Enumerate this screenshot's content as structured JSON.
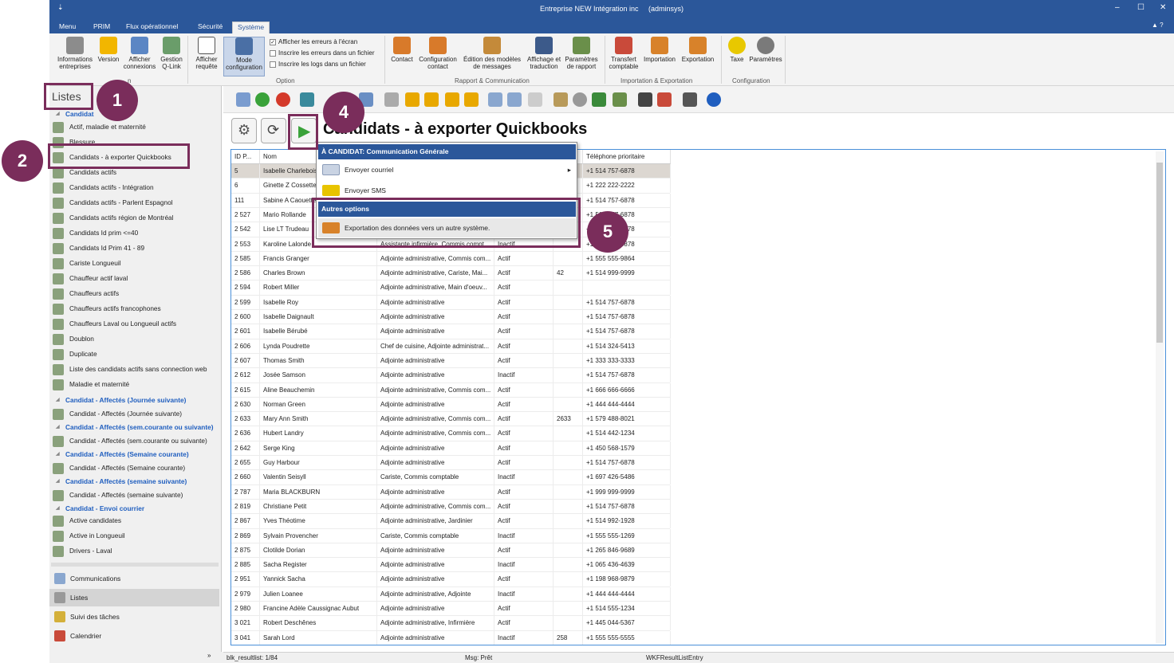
{
  "window": {
    "title": "Entreprise NEW Intégration inc",
    "user": "(adminsys)",
    "controls": [
      "–",
      "☐",
      "✕"
    ]
  },
  "menu_tabs": [
    "Menu",
    "PRIM",
    "Flux opérationnel",
    "Sécurité",
    "Système"
  ],
  "ribbon": {
    "buttons": [
      {
        "label": "Informations entreprises",
        "icon": "building-icon"
      },
      {
        "label": "Version",
        "icon": "warning-icon"
      },
      {
        "label": "Afficher connexions",
        "icon": "network-icon"
      },
      {
        "label": "Gestion Q-Link",
        "icon": "link-icon"
      },
      {
        "label": "Afficher requête",
        "icon": "log-icon"
      },
      {
        "label": "Mode configuration",
        "icon": "globe-icon"
      },
      {
        "label": "Contact",
        "icon": "contact-icon"
      },
      {
        "label": "Configuration contact",
        "icon": "contact-config-icon"
      },
      {
        "label": "Édition des modèles de messages",
        "icon": "edit-icon"
      },
      {
        "label": "Affichage et traduction",
        "icon": "translate-icon"
      },
      {
        "label": "Paramètres de rapport",
        "icon": "report-icon"
      },
      {
        "label": "Transfert comptable",
        "icon": "transfer-icon"
      },
      {
        "label": "Importation",
        "icon": "import-icon"
      },
      {
        "label": "Exportation",
        "icon": "export-icon"
      },
      {
        "label": "Taxe",
        "icon": "tax-icon"
      },
      {
        "label": "Paramètres",
        "icon": "gear-icon"
      }
    ],
    "checkboxes": [
      {
        "label": "Afficher les erreurs à l'écran",
        "checked": true
      },
      {
        "label": "Inscrire les erreurs dans un fichier",
        "checked": false
      },
      {
        "label": "Inscrire les logs dans un fichier",
        "checked": false
      }
    ],
    "groups": [
      "n",
      "Option",
      "Rapport & Communication",
      "Importation & Exportation",
      "Configuration"
    ]
  },
  "sidebar": {
    "title": "Listes",
    "items": [
      {
        "type": "head",
        "label": "Candidat"
      },
      {
        "type": "item",
        "label": "Actif, maladie et maternité"
      },
      {
        "type": "item",
        "label": "Blessure"
      },
      {
        "type": "item",
        "label": "Candidats - à exporter Quickbooks"
      },
      {
        "type": "item",
        "label": "Candidats actifs"
      },
      {
        "type": "item",
        "label": "Candidats actifs - Intégration"
      },
      {
        "type": "item",
        "label": "Candidats actifs - Parlent Espagnol"
      },
      {
        "type": "item",
        "label": "Candidats actifs région de Montréal"
      },
      {
        "type": "item",
        "label": "Candidats Id prim <=40"
      },
      {
        "type": "item",
        "label": "Candidats Id Prim 41 - 89"
      },
      {
        "type": "item",
        "label": "Cariste Longueuil"
      },
      {
        "type": "item",
        "label": "Chauffeur actif laval"
      },
      {
        "type": "item",
        "label": "Chauffeurs actifs"
      },
      {
        "type": "item",
        "label": "Chauffeurs actifs francophones"
      },
      {
        "type": "item",
        "label": "Chauffeurs Laval ou Longueuil actifs"
      },
      {
        "type": "item",
        "label": "Doublon"
      },
      {
        "type": "item",
        "label": "Duplicate"
      },
      {
        "type": "item",
        "label": "Liste des candidats actifs sans connection web"
      },
      {
        "type": "item",
        "label": "Maladie et maternité"
      },
      {
        "type": "head",
        "label": "Candidat - Affectés (Journée suivante)"
      },
      {
        "type": "item",
        "label": "Candidat - Affectés (Journée suivante)"
      },
      {
        "type": "head",
        "label": "Candidat - Affectés (sem.courante ou suivante)"
      },
      {
        "type": "item",
        "label": "Candidat - Affectés (sem.courante ou suivante)"
      },
      {
        "type": "head",
        "label": "Candidat - Affectés (Semaine courante)"
      },
      {
        "type": "item",
        "label": "Candidat - Affectés (Semaine courante)"
      },
      {
        "type": "head",
        "label": "Candidat - Affectés (semaine suivante)"
      },
      {
        "type": "item",
        "label": "Candidat - Affectés (semaine suivante)"
      },
      {
        "type": "head",
        "label": "Candidat - Envoi courrier"
      },
      {
        "type": "item",
        "label": "Active candidates"
      },
      {
        "type": "item",
        "label": "Active in Longueuil"
      },
      {
        "type": "item",
        "label": "Drivers - Laval"
      }
    ],
    "nav": [
      {
        "label": "Communications",
        "icon": "communications-icon",
        "active": false
      },
      {
        "label": "Listes",
        "icon": "list-icon",
        "active": true
      },
      {
        "label": "Suivi des tâches",
        "icon": "tasks-icon",
        "active": false
      },
      {
        "label": "Calendrier",
        "icon": "calendar-icon",
        "active": false
      }
    ]
  },
  "page": {
    "title": "Candidats - à exporter Quickbooks"
  },
  "grid": {
    "columns": [
      "ID P...",
      "Nom",
      "",
      "",
      "",
      "Téléphone prioritaire"
    ],
    "rows": [
      [
        "5",
        "Isabelle Charlebois",
        "",
        "",
        "",
        "+1 514 757-6878"
      ],
      [
        "6",
        "Ginette Z Cossette",
        "",
        "",
        "",
        "+1 222 222-2222"
      ],
      [
        "111",
        "Sabine A Caouette",
        "",
        "",
        "",
        "+1 514 757-6878"
      ],
      [
        "2 527",
        "Mario Rollande",
        "",
        "",
        "",
        "+1 514 757-6878"
      ],
      [
        "2 542",
        "Lise LT Trudeau",
        "",
        "",
        "",
        "+1 514 757-6878"
      ],
      [
        "2 553",
        "Karoline Lalonde",
        "Assistante infirmière, Commis compt...",
        "Inactif",
        "",
        "+1 514 757-6878"
      ],
      [
        "2 585",
        "Francis Granger",
        "Adjointe administrative, Commis com...",
        "Actif",
        "",
        "+1 555 555-9864"
      ],
      [
        "2 586",
        "Charles Brown",
        "Adjointe administrative, Cariste, Mai...",
        "Actif",
        "42",
        "+1 514 999-9999"
      ],
      [
        "2 594",
        "Robert Miller",
        "Adjointe administrative, Main d'oeuv...",
        "Actif",
        "",
        ""
      ],
      [
        "2 599",
        "Isabelle Roy",
        "Adjointe administrative",
        "Actif",
        "",
        "+1 514 757-6878"
      ],
      [
        "2 600",
        "Isabelle Daignault",
        "Adjointe administrative",
        "Actif",
        "",
        "+1 514 757-6878"
      ],
      [
        "2 601",
        "Isabelle Bérubé",
        "Adjointe administrative",
        "Actif",
        "",
        "+1 514 757-6878"
      ],
      [
        "2 606",
        "Lynda Poudrette",
        "Chef de cuisine, Adjointe administrat...",
        "Actif",
        "",
        "+1 514 324-5413"
      ],
      [
        "2 607",
        "Thomas Smith",
        "Adjointe administrative",
        "Actif",
        "",
        "+1 333 333-3333"
      ],
      [
        "2 612",
        "Josée Samson",
        "Adjointe administrative",
        "Inactif",
        "",
        "+1 514 757-6878"
      ],
      [
        "2 615",
        "Aline Beauchemin",
        "Adjointe administrative, Commis com...",
        "Actif",
        "",
        "+1 666 666-6666"
      ],
      [
        "2 630",
        "Norman Green",
        "Adjointe administrative",
        "Actif",
        "",
        "+1 444 444-4444"
      ],
      [
        "2 633",
        "Mary Ann Smith",
        "Adjointe administrative, Commis com...",
        "Actif",
        "2633",
        "+1 579 488-8021"
      ],
      [
        "2 636",
        "Hubert Landry",
        "Adjointe administrative, Commis com...",
        "Actif",
        "",
        "+1 514 442-1234"
      ],
      [
        "2 642",
        "Serge King",
        "Adjointe administrative",
        "Actif",
        "",
        "+1 450 568-1579"
      ],
      [
        "2 655",
        "Guy Harbour",
        "Adjointe administrative",
        "Actif",
        "",
        "+1 514 757-6878"
      ],
      [
        "2 660",
        "Valentin Seisyll",
        "Cariste, Commis comptable",
        "Inactif",
        "",
        "+1 697 426-5486"
      ],
      [
        "2 787",
        "Maria BLACKBURN",
        "Adjointe administrative",
        "Actif",
        "",
        "+1 999 999-9999"
      ],
      [
        "2 819",
        "Christiane Petit",
        "Adjointe administrative, Commis com...",
        "Actif",
        "",
        "+1 514 757-6878"
      ],
      [
        "2 867",
        "Yves Théotime",
        "Adjointe administrative, Jardinier",
        "Actif",
        "",
        "+1 514 992-1928"
      ],
      [
        "2 869",
        "Sylvain Provencher",
        "Cariste, Commis comptable",
        "Inactif",
        "",
        "+1 555 555-1269"
      ],
      [
        "2 875",
        "Clotilde Dorian",
        "Adjointe administrative",
        "Actif",
        "",
        "+1 265 846-9689"
      ],
      [
        "2 885",
        "Sacha Register",
        "Adjointe administrative",
        "Inactif",
        "",
        "+1 065 436-4639"
      ],
      [
        "2 951",
        "Yannick Sacha",
        "Adjointe administrative",
        "Actif",
        "",
        "+1 198 968-9879"
      ],
      [
        "2 979",
        "Julien Loanee",
        "Adjointe administrative, Adjointe",
        "Inactif",
        "",
        "+1 444 444-4444"
      ],
      [
        "2 980",
        "Francine Adèle Caussignac Aubut",
        "Adjointe administrative",
        "Actif",
        "",
        "+1 514 555-1234"
      ],
      [
        "3 021",
        "Robert Deschênes",
        "Adjointe administrative, Infirmière",
        "Actif",
        "",
        "+1 445 044-5367"
      ],
      [
        "3 041",
        "Sarah Lord",
        "Adjointe administrative",
        "Inactif",
        "258",
        "+1 555 555-5555"
      ]
    ]
  },
  "popup": {
    "header1": "À CANDIDAT: Communication Générale",
    "items1": [
      {
        "label": "Envoyer courriel",
        "icon": "email-icon",
        "submenu": "▸"
      },
      {
        "label": "Envoyer SMS",
        "icon": "sms-icon"
      }
    ],
    "header2": "Autres options",
    "items2": [
      {
        "label": "Exportation des données vers un autre système.",
        "icon": "export-data-icon"
      }
    ]
  },
  "callouts": [
    "1",
    "2",
    "4",
    "5"
  ],
  "status": {
    "left": "blk_resultlist: 1/84",
    "mid": "Msg: Prêt",
    "right": "WKFResultListEntry"
  },
  "colors": {
    "accent": "#2b579a",
    "callout": "#7a2d5b",
    "selected_row": "#dcd7d1",
    "link_heading": "#1f5ebf"
  }
}
